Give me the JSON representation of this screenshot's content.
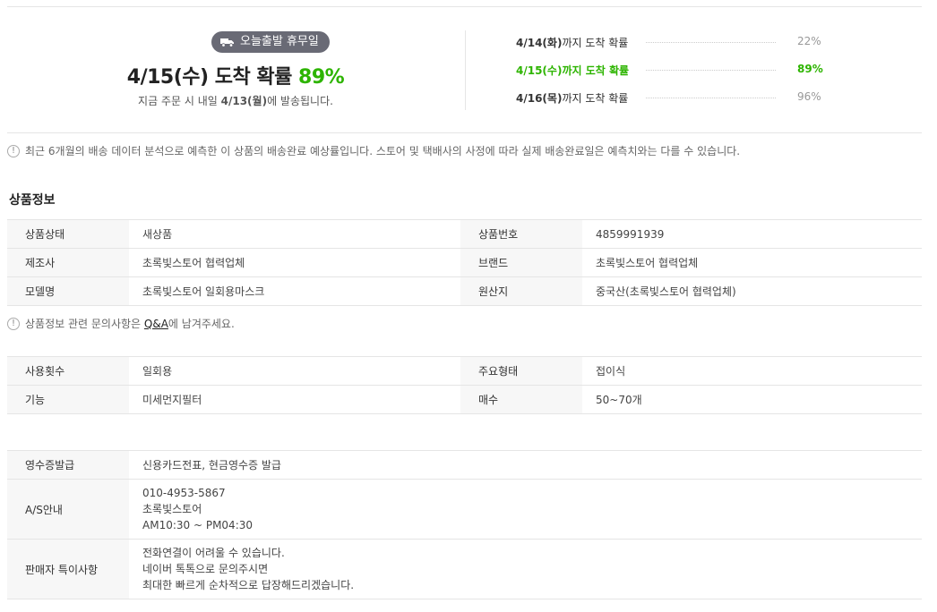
{
  "delivery": {
    "badge_label": "오늘출발 휴무일",
    "headline_prefix": "4/15(수) 도착 확률",
    "headline_percent": "89%",
    "sub_prefix": "지금 주문 시 내일",
    "sub_date": "4/13(월)",
    "sub_suffix": "에 발송됩니다.",
    "rows": [
      {
        "date": "4/14(화)",
        "text": "까지 도착 확률",
        "value": "22%"
      },
      {
        "date": "4/15(수)",
        "text": "까지 도착 확률",
        "value": "89%"
      },
      {
        "date": "4/16(목)",
        "text": "까지 도착 확률",
        "value": "96%"
      }
    ],
    "notice": "최근 6개월의 배송 데이터 분석으로 예측한 이 상품의 배송완료 예상률입니다. 스토어 및 택배사의 사정에 따라 실제 배송완료일은 예측치와는 다를 수 있습니다."
  },
  "product_info": {
    "title": "상품정보",
    "rows": [
      {
        "k1": "상품상태",
        "v1": "새상품",
        "k2": "상품번호",
        "v2": "4859991939"
      },
      {
        "k1": "제조사",
        "v1": "초록빛스토어 협력업체",
        "k2": "브랜드",
        "v2": "초록빛스토어 협력업체"
      },
      {
        "k1": "모델명",
        "v1": "초록빛스토어 일회용마스크",
        "k2": "원산지",
        "v2": "중국산(초록빛스토어 협력업체)"
      }
    ],
    "qa_prefix": "상품정보 관련 문의사항은",
    "qa_link": "Q&A",
    "qa_suffix": "에 남겨주세요."
  },
  "attributes": {
    "rows": [
      {
        "k1": "사용횟수",
        "v1": "일회용",
        "k2": "주요형태",
        "v2": "접이식"
      },
      {
        "k1": "기능",
        "v1": "미세먼지필터",
        "k2": "매수",
        "v2": "50~70개"
      }
    ]
  },
  "seller": {
    "receipt_label": "영수증발급",
    "receipt_value": "신용카드전표, 현금영수증 발급",
    "as_label": "A/S안내",
    "as_lines": [
      "010-4953-5867",
      "초록빛스토어",
      "AM10:30 ~ PM04:30"
    ],
    "notes_label": "판매자 특이사항",
    "notes_lines": [
      "전화연결이 어려울 수 있습니다.",
      "네이버 톡톡으로 문의주시면",
      "최대한 빠르게 순차적으로 답장해드리겠습니다."
    ]
  },
  "colors": {
    "accent_green": "#2db400",
    "badge_bg": "#696a75"
  },
  "icons": {
    "badge": "truck-icon",
    "notice": "info-circle-icon"
  }
}
